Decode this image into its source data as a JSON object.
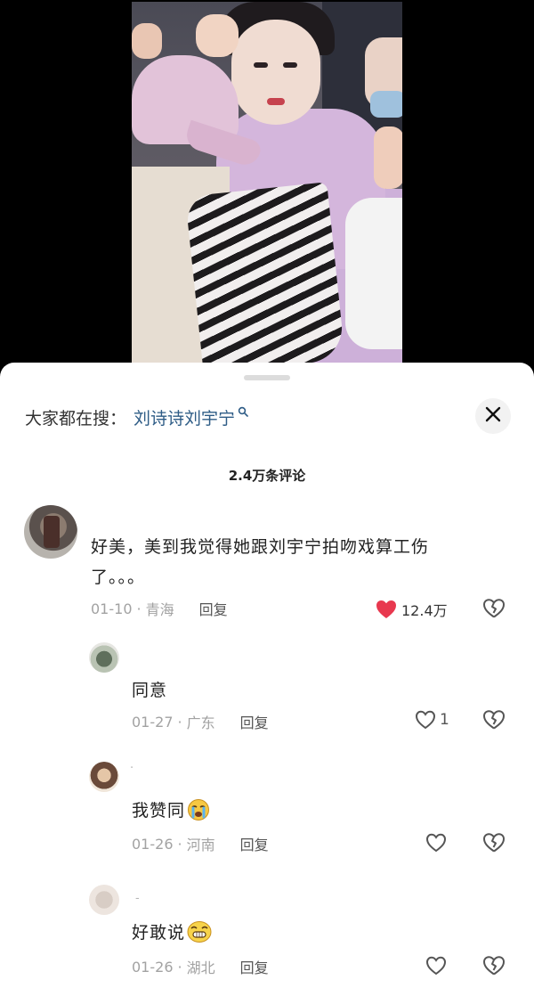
{
  "search": {
    "prefix": "大家都在搜：",
    "term": "刘诗诗刘宇宁"
  },
  "comments_header": {
    "count_label": "2.4万条评论"
  },
  "main_comment": {
    "text": "好美，美到我觉得她跟刘宇宁拍吻戏算工伤了。。。",
    "date": "01-10",
    "location": "青海",
    "reply_label": "回复",
    "like_count": "12.4万",
    "liked": true
  },
  "replies": [
    {
      "name": "",
      "text": "同意",
      "emoji": "",
      "date": "01-27",
      "location": "广东",
      "reply_label": "回复",
      "like_count": "1"
    },
    {
      "name": "·",
      "text": "我赞同",
      "emoji": "crying-face",
      "date": "01-26",
      "location": "河南",
      "reply_label": "回复",
      "like_count": ""
    },
    {
      "name": "-",
      "text": "好敢说",
      "emoji": "grimace-face",
      "date": "01-26",
      "location": "湖北",
      "reply_label": "回复",
      "like_count": ""
    }
  ],
  "meta_separator": "·",
  "colors": {
    "like_red": "#e8384f",
    "search_term_blue": "#2e5c86",
    "meta_gray": "#a2a2a2"
  },
  "icons": {
    "close": "close-icon",
    "like": "heart-icon",
    "dislike": "broken-heart-icon",
    "search": "search-icon"
  }
}
